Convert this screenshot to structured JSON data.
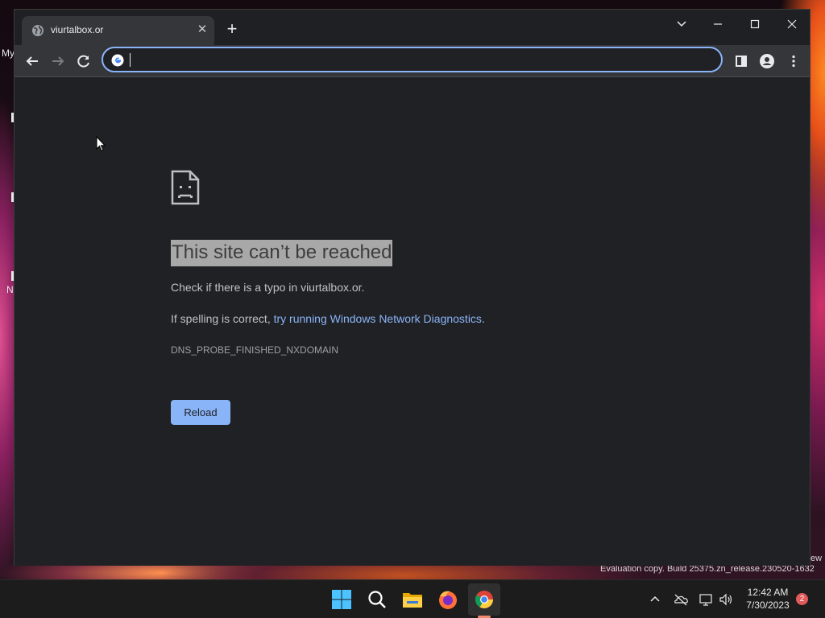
{
  "desktop": {
    "label_fragment_1": "My",
    "label_fragment_2": "N",
    "watermark_new": "ew",
    "watermark": "Evaluation copy. Build 25375.zn_release.230520-1632"
  },
  "browser": {
    "tab": {
      "title": "viurtalbox.or",
      "favicon": "globe-icon"
    },
    "omnibox": {
      "value": "",
      "placeholder": ""
    },
    "error": {
      "title": "This site can’t be reached",
      "line1": "Check if there is a typo in viurtalbox.or.",
      "line2_prefix": "If spelling is correct, ",
      "line2_link": "try running Windows Network Diagnostics",
      "line2_suffix": ".",
      "code": "DNS_PROBE_FINISHED_NXDOMAIN",
      "reload_label": "Reload"
    }
  },
  "taskbar": {
    "apps": [
      "start-icon",
      "search-icon",
      "file-explorer-icon",
      "firefox-icon",
      "chrome-icon"
    ],
    "active_app": "chrome-icon",
    "time": "12:42 AM",
    "date": "7/30/2023",
    "notification_count": "2"
  },
  "colors": {
    "accent": "#8ab4f8",
    "page_bg": "#202124",
    "toolbar_bg": "#35363a",
    "title_highlight": "#a8a8a8"
  }
}
